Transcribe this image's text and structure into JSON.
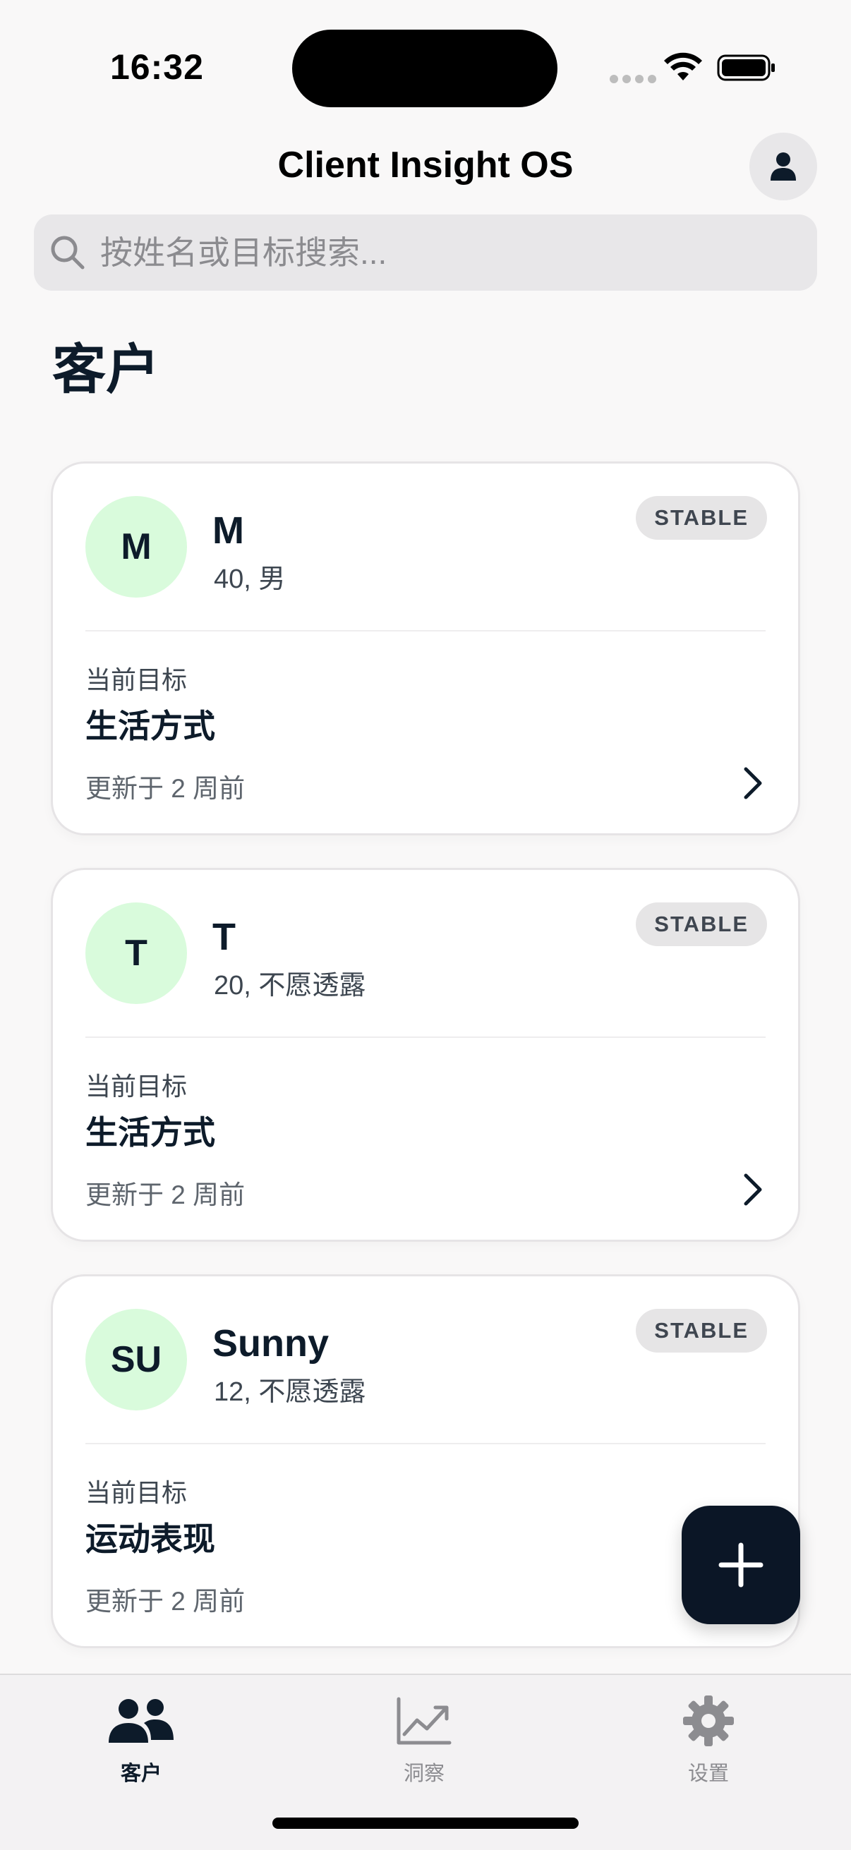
{
  "status_bar": {
    "time": "16:32"
  },
  "header": {
    "title": "Client Insight OS"
  },
  "search": {
    "placeholder": "按姓名或目标搜索..."
  },
  "section": {
    "title": "客户"
  },
  "clients": [
    {
      "initials": "M",
      "name": "M",
      "meta": "40, 男",
      "status": "STABLE",
      "goal_label": "当前目标",
      "goal": "生活方式",
      "updated": "更新于 2 周前"
    },
    {
      "initials": "T",
      "name": "T",
      "meta": "20, 不愿透露",
      "status": "STABLE",
      "goal_label": "当前目标",
      "goal": "生活方式",
      "updated": "更新于 2 周前"
    },
    {
      "initials": "SU",
      "name": "Sunny",
      "meta": "12, 不愿透露",
      "status": "STABLE",
      "goal_label": "当前目标",
      "goal": "运动表现",
      "updated": "更新于 2 周前"
    }
  ],
  "tabs": [
    {
      "label": "客户",
      "icon": "users-icon",
      "active": true
    },
    {
      "label": "洞察",
      "icon": "chart-line-icon",
      "active": false
    },
    {
      "label": "设置",
      "icon": "gear-icon",
      "active": false
    }
  ],
  "colors": {
    "accent": "#0b1626",
    "avatar_bg": "#d9fbdc",
    "badge_bg": "#e6e5e6",
    "background": "#f9f8f8"
  }
}
